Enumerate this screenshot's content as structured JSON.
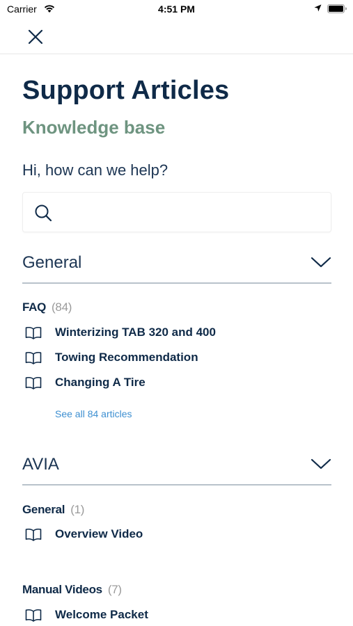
{
  "status_bar": {
    "carrier": "Carrier",
    "time": "4:51 PM",
    "icons": [
      "wifi-icon",
      "location-icon",
      "battery-icon"
    ]
  },
  "nav": {
    "close_icon": "close-icon"
  },
  "header": {
    "title": "Support Articles",
    "subtitle": "Knowledge base"
  },
  "search": {
    "prompt": "Hi, how can we help?",
    "placeholder": "",
    "value": ""
  },
  "sections": [
    {
      "title": "General",
      "categories": [
        {
          "title": "FAQ",
          "count": "(84)",
          "articles": [
            "Winterizing TAB 320 and 400",
            "Towing Recommendation",
            "Changing A Tire"
          ],
          "see_all": "See all 84 articles"
        }
      ]
    },
    {
      "title": "AVIA",
      "categories": [
        {
          "title": "General",
          "count": "(1)",
          "articles": [
            "Overview Video"
          ]
        },
        {
          "title": "Manual Videos",
          "count": "(7)",
          "articles": [
            "Welcome Packet"
          ]
        }
      ]
    }
  ],
  "colors": {
    "navy": "#0f2a48",
    "sage_green": "#6e9480",
    "link_blue": "#3d8fd1",
    "muted_gray": "#9a9a9a",
    "divider": "#b8c2cb"
  }
}
